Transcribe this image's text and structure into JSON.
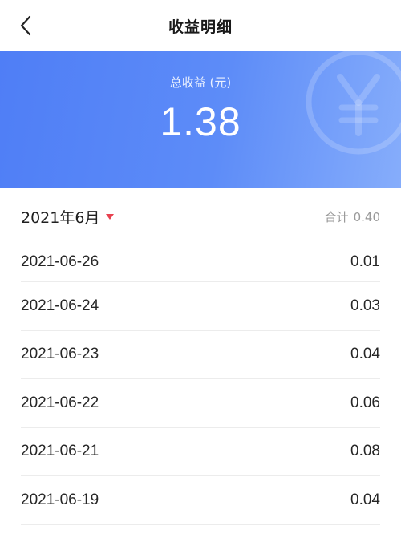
{
  "header": {
    "back_icon": "chevron-left-icon",
    "title": "收益明细"
  },
  "summary": {
    "label": "总收益 (元)",
    "value": "1.38",
    "watermark_icon": "yen-icon",
    "gradient_start": "#4f7ef6",
    "gradient_end": "#86adfb"
  },
  "month": {
    "label": "2021年6月",
    "caret_icon": "caret-down-icon",
    "caret_color": "#e8414f",
    "total_label": "合计",
    "total_value": "0.40"
  },
  "records": [
    {
      "date": "2021-06-26",
      "amount": "0.01"
    },
    {
      "date": "2021-06-24",
      "amount": "0.03"
    },
    {
      "date": "2021-06-23",
      "amount": "0.04"
    },
    {
      "date": "2021-06-22",
      "amount": "0.06"
    },
    {
      "date": "2021-06-21",
      "amount": "0.08"
    },
    {
      "date": "2021-06-19",
      "amount": "0.04"
    }
  ]
}
